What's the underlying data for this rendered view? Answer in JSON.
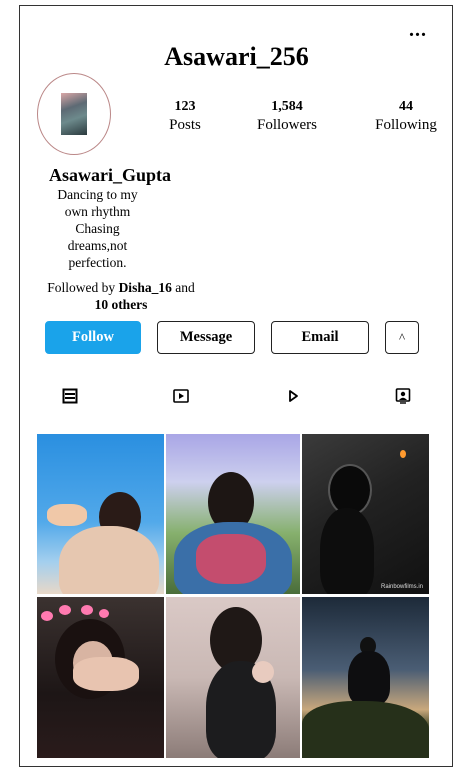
{
  "profile": {
    "username": "Asawari_256",
    "full_name": "Asawari_Gupta",
    "bio_lines": [
      "Dancing to my",
      "own rhythm",
      "Chasing",
      "dreams,not",
      "perfection."
    ],
    "stats": {
      "posts": {
        "value": "123",
        "label": "Posts"
      },
      "followers": {
        "value": "1,584",
        "label": "Followers"
      },
      "following": {
        "value": "44",
        "label": "Following"
      }
    },
    "followed_by": {
      "prefix": "Followed by",
      "user": "Disha_16",
      "conjunction": "and",
      "others": "10 others"
    }
  },
  "header": {
    "more_label": "..."
  },
  "buttons": {
    "follow": "Follow",
    "message": "Message",
    "email": "Email",
    "more": "^"
  },
  "tabs": [
    {
      "icon": "posts-grid-icon"
    },
    {
      "icon": "reels-icon"
    },
    {
      "icon": "play-icon"
    },
    {
      "icon": "tagged-icon"
    }
  ],
  "grid": {
    "watermark": "Rainbowfilms.in"
  },
  "colors": {
    "accent": "#1aa3ea",
    "border": "#222222"
  }
}
